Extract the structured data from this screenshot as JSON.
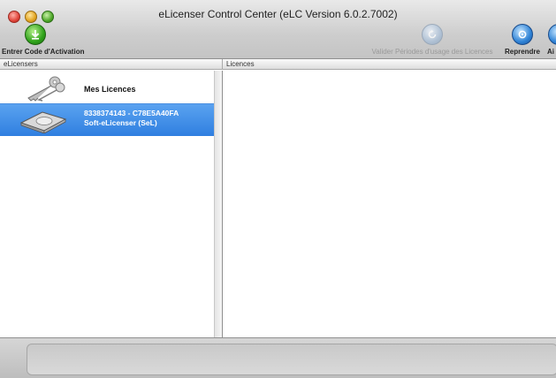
{
  "window": {
    "title": "eLicenser Control Center (eLC Version 6.0.2.7002)"
  },
  "toolbar": {
    "enter_code_label": "Entrer Code d'Activation",
    "validate_label": "Valider Périodes d'usage des Licences",
    "reprendre_label": "Reprendre",
    "cut_label": "Ai"
  },
  "columns": {
    "left_header": "eLicensers",
    "right_header": "Licences"
  },
  "elicensers": [
    {
      "label": "Mes Licences",
      "icon": "keys-icon"
    },
    {
      "label": "8338374143 - C78E5A40FA",
      "sublabel": "Soft-eLicenser (SeL)",
      "icon": "hard-drive-icon",
      "selected": true
    }
  ],
  "colors": {
    "selection": "#3a86e6",
    "accent_green": "#2fa21a",
    "accent_blue": "#2f83d6"
  }
}
